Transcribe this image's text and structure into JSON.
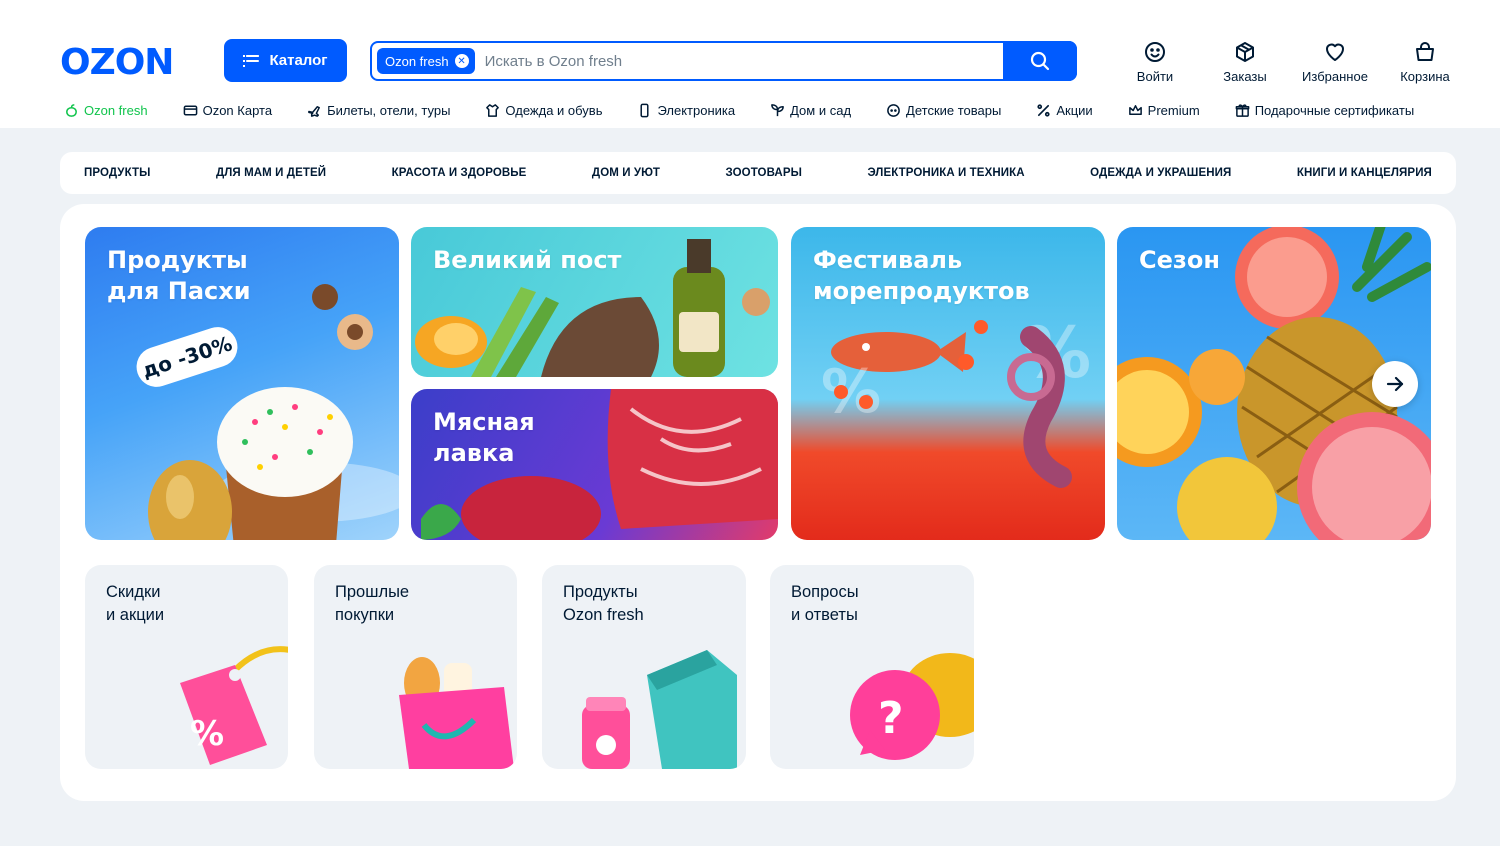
{
  "header": {
    "logo": "OZON",
    "catalog_label": "Каталог",
    "search": {
      "chip": "Ozon fresh",
      "placeholder": "Искать в Ozon fresh",
      "value": ""
    },
    "actions": [
      {
        "label": "Войти",
        "icon": "smile-icon"
      },
      {
        "label": "Заказы",
        "icon": "box-icon"
      },
      {
        "label": "Избранное",
        "icon": "heart-icon"
      },
      {
        "label": "Корзина",
        "icon": "bag-icon"
      }
    ]
  },
  "menu": [
    {
      "label": "Ozon fresh",
      "icon": "fresh-icon"
    },
    {
      "label": "Ozon Карта",
      "icon": "card-icon"
    },
    {
      "label": "Билеты, отели, туры",
      "icon": "plane-icon"
    },
    {
      "label": "Одежда и обувь",
      "icon": "clothes-icon"
    },
    {
      "label": "Электроника",
      "icon": "phone-icon"
    },
    {
      "label": "Дом и сад",
      "icon": "plant-icon"
    },
    {
      "label": "Детские товары",
      "icon": "baby-icon"
    },
    {
      "label": "Акции",
      "icon": "percent-icon"
    },
    {
      "label": "Premium",
      "icon": "crown-icon"
    },
    {
      "label": "Подарочные сертификаты",
      "icon": "gift-icon"
    }
  ],
  "categories": [
    "ПРОДУКТЫ",
    "ДЛЯ МАМ И ДЕТЕЙ",
    "КРАСОТА И ЗДОРОВЬЕ",
    "ДОМ И УЮТ",
    "ЗООТОВАРЫ",
    "ЭЛЕКТРОНИКА И ТЕХНИКА",
    "ОДЕЖДА И УКРАШЕНИЯ",
    "КНИГИ И КАНЦЕЛЯРИЯ"
  ],
  "banners": [
    {
      "title": "Продукты\nдля Пасхи",
      "badge": "до -30%"
    },
    {
      "title": "Великий пост"
    },
    {
      "title": "Мясная\nлавка"
    },
    {
      "title": "Фестиваль\nморепродуктов"
    },
    {
      "title": "Сезон"
    }
  ],
  "tiles": [
    {
      "title": "Скидки\nи акции"
    },
    {
      "title": "Прошлые\nпокупки"
    },
    {
      "title": "Продукты\nOzon fresh"
    },
    {
      "title": "Вопросы\nи ответы"
    }
  ],
  "colors": {
    "brand": "#005bff",
    "fresh": "#10c44c",
    "background": "#eef2f6",
    "text": "#001a34"
  }
}
